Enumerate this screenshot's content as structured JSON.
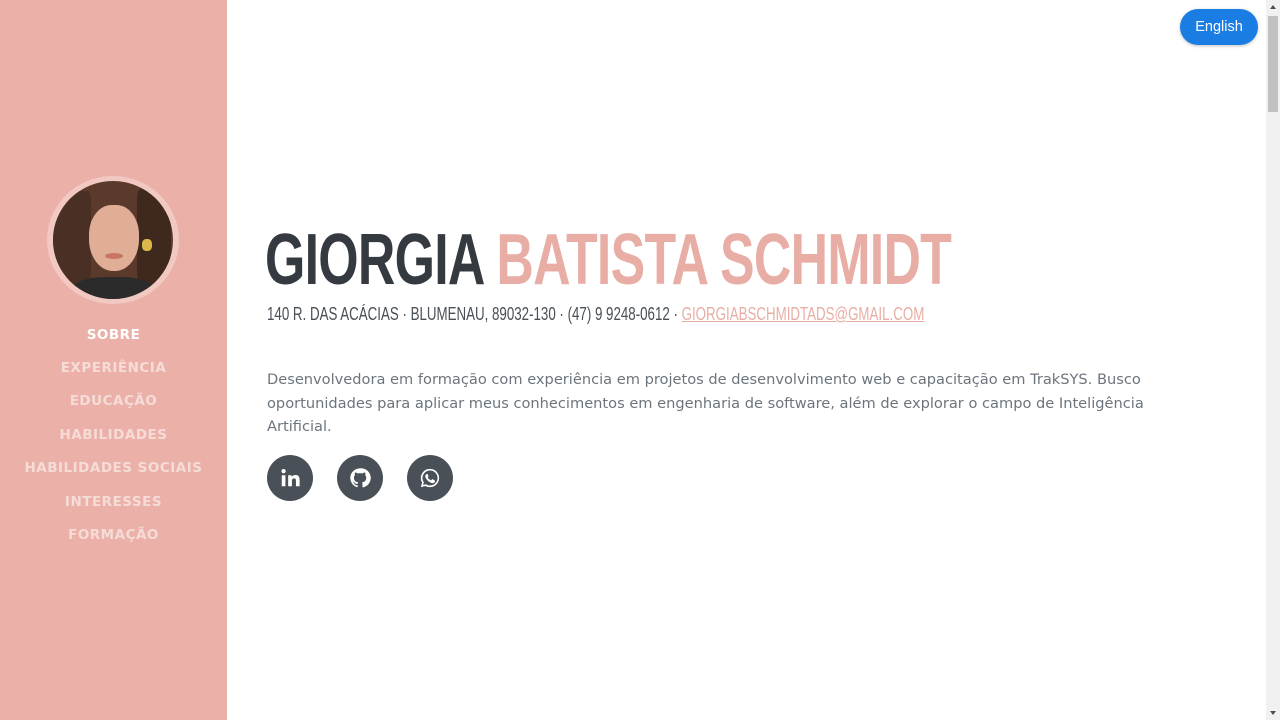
{
  "sidebar": {
    "avatar_alt": "Giorgia Batista Schmidt",
    "nav": [
      {
        "label": "SOBRE",
        "active": true
      },
      {
        "label": "EXPERIÊNCIA",
        "active": false
      },
      {
        "label": "EDUCAÇÃO",
        "active": false
      },
      {
        "label": "HABILIDADES",
        "active": false
      },
      {
        "label": "HABILIDADES SOCIAIS",
        "active": false
      },
      {
        "label": "INTERESSES",
        "active": false
      },
      {
        "label": "FORMAÇÃO",
        "active": false
      }
    ]
  },
  "header": {
    "language_button": "English"
  },
  "profile": {
    "first_name": "GIORGIA",
    "last_name": "BATISTA SCHMIDT",
    "contact_text": "140 R. DAS ACÁCIAS · BLUMENAU, 89032-130 · (47) 9 9248-0612 · ",
    "email": "GIORGIABSCHMIDTADS@GMAIL.COM",
    "summary": "Desenvolvedora em formação com experiência em projetos de desenvolvimento web e capacitação em TrakSYS. Busco oportunidades para aplicar meus conhecimentos em engenharia de software, além de explorar o campo de Inteligência Artificial."
  },
  "socials": [
    {
      "icon": "linkedin-icon"
    },
    {
      "icon": "github-icon"
    },
    {
      "icon": "whatsapp-icon"
    }
  ],
  "colors": {
    "sidebar_bg": "#ebb1a8",
    "accent": "#e8aea5",
    "dark": "#343a40",
    "button_blue": "#1a7de3"
  }
}
